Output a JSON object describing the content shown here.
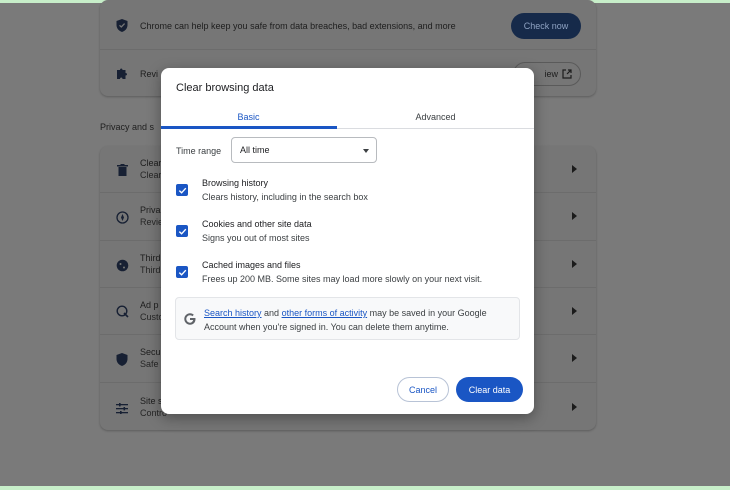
{
  "background": {
    "safety_card": {
      "row1_text": "Chrome can help keep you safe from data breaches, bad extensions, and more",
      "check_now_label": "Check now",
      "row2_text": "Revi",
      "review_label": "iew"
    },
    "privacy_heading": "Privacy and s",
    "privacy_rows": [
      {
        "icon": "trash-icon",
        "line1": "Clear",
        "line2": "Clear"
      },
      {
        "icon": "privacy-guide-icon",
        "line1": "Priva",
        "line2": "Revie"
      },
      {
        "icon": "cookie-icon",
        "line1": "Third",
        "line2": "Third"
      },
      {
        "icon": "ad-privacy-icon",
        "line1": "Ad p",
        "line2": "Custo"
      },
      {
        "icon": "shield-icon",
        "line1": "Secu",
        "line2": "Safe"
      },
      {
        "icon": "tune-icon",
        "line1": "Site s",
        "line2": "Contro"
      }
    ]
  },
  "dialog": {
    "title": "Clear browsing data",
    "tabs": [
      {
        "label": "Basic",
        "active": true
      },
      {
        "label": "Advanced",
        "active": false
      }
    ],
    "time_range": {
      "label": "Time range",
      "value": "All time"
    },
    "options": [
      {
        "title": "Browsing history",
        "subtitle": "Clears history, including in the search box",
        "checked": true
      },
      {
        "title": "Cookies and other site data",
        "subtitle": "Signs you out of most sites",
        "checked": true
      },
      {
        "title": "Cached images and files",
        "subtitle": "Frees up 200 MB. Some sites may load more slowly on your next visit.",
        "checked": true
      }
    ],
    "info": {
      "link1": "Search history",
      "text1": " and ",
      "link2": "other forms of activity",
      "text2": " may be saved in your Google",
      "line2": "Account when you're signed in. You can delete them anytime."
    },
    "buttons": {
      "cancel": "Cancel",
      "clear": "Clear data"
    }
  },
  "colors": {
    "accent": "#1a56c4",
    "overlay": "#7a7a7a"
  }
}
